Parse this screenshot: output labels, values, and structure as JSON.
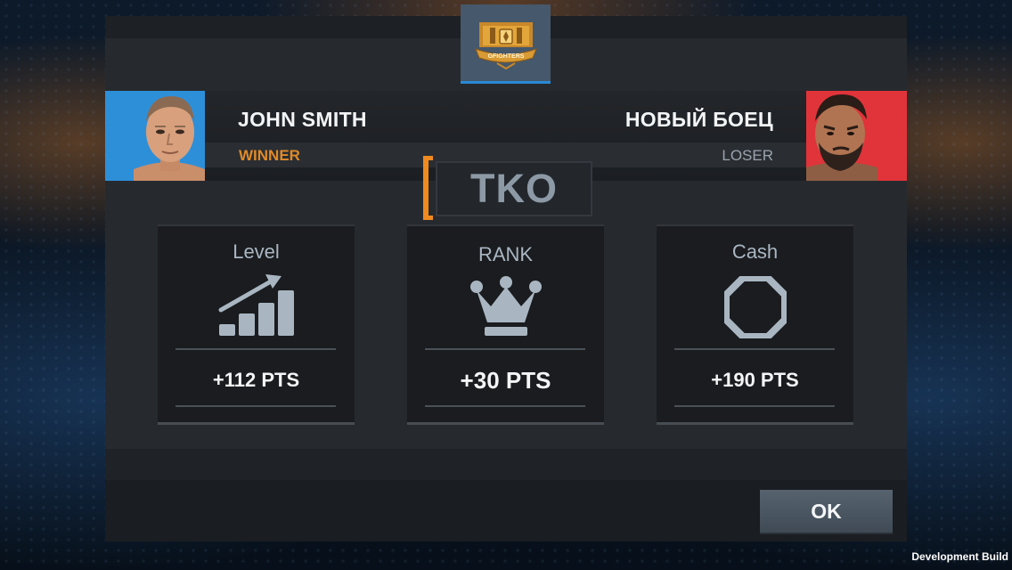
{
  "emblem": {
    "icon": "arena-emblem-icon",
    "text": "GFIGHTERS"
  },
  "fighters": {
    "left": {
      "name": "JOHN SMITH",
      "result": "WINNER",
      "corner_color": "#2e8fd9"
    },
    "right": {
      "name": "НОВЫЙ БОЕЦ",
      "result": "LOSER",
      "corner_color": "#e0343a"
    }
  },
  "method": "TKO",
  "rewards": [
    {
      "title": "Level",
      "icon": "level-up-chart-icon",
      "value": "+112 PTS"
    },
    {
      "title": "RANK",
      "icon": "crown-icon",
      "value": "+30 PTS"
    },
    {
      "title": "Cash",
      "icon": "octagon-icon",
      "value": "+190 PTS"
    }
  ],
  "ok_label": "OK",
  "footer_note": "Development Build",
  "colors": {
    "winner": "#e08a28",
    "loser": "#9aa3ad",
    "accent_blue": "#2a8ad6",
    "accent_orange": "#f08a1e"
  }
}
